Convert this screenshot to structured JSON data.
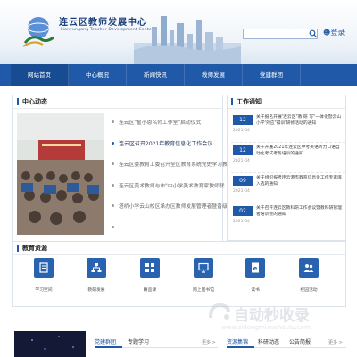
{
  "header": {
    "logo_title": "连云区教师发展中心",
    "logo_subtitle": "Lianyungang Teacher Development Center",
    "search_placeholder": "",
    "login_label": "登录"
  },
  "nav": {
    "items": [
      "网站首页",
      "中心概况",
      "新闻快讯",
      "教师发展",
      "党建群团"
    ]
  },
  "center_news": {
    "title": "中心动态",
    "items": [
      {
        "text": "连云区\"星小恩名师工作室\"启动仪式",
        "active": false
      },
      {
        "text": "连云区召开2021年教育信息化工作会议",
        "active": true
      },
      {
        "text": "连云区委教育工委召开全区教育系统党史学习教",
        "active": false
      },
      {
        "text": "连云区美术教师与市\"中小学美术教育家教师联",
        "active": false
      },
      {
        "text": "塔桥小学云山校区承办区教师发展管理者暨晋级",
        "active": false
      },
      {
        "text": "",
        "active": false
      }
    ]
  },
  "work_notice": {
    "title": "工作通知",
    "items": [
      {
        "day": "12",
        "year": "2021-04",
        "text": "关于报名开展'连云区\"教 研 写\"一体化暨云山小学'外应\"得训'研修活动的通知"
      },
      {
        "day": "12",
        "year": "2021-04",
        "text": "关于开展2021年连云区中考英语听力口语自动化考试考务培训的通知"
      },
      {
        "day": "09",
        "year": "2021-04",
        "text": "关于组织报考连云港市教育信息化工作专家库入选的通知"
      },
      {
        "day": "02",
        "year": "2021-04",
        "text": "关于召开连云区教科研工作会议暨教科研管理者培训会的通知"
      }
    ]
  },
  "resources": {
    "title": "教育资源",
    "items": [
      {
        "label": "学习空间",
        "icon": "book-icon"
      },
      {
        "label": "教研发展",
        "icon": "network-icon"
      },
      {
        "label": "精品课",
        "icon": "grid-icon"
      },
      {
        "label": "网上图书馆",
        "icon": "monitor-icon"
      },
      {
        "label": "读书",
        "icon": "ebook-icon"
      },
      {
        "label": "校园活动",
        "icon": "people-icon"
      }
    ]
  },
  "bottom": {
    "tabs_left": [
      "党建群团",
      "专题学习"
    ],
    "tabs_right": [
      "资源集锦",
      "科研动态",
      "公告简报"
    ],
    "more_label": "更多 >"
  },
  "watermark": {
    "text": "自动秒收录",
    "url": "www.zidongmiaoshoulu.com"
  },
  "colors": {
    "primary": "#2059a7",
    "nav_bg": "#2059a7",
    "date_badge": "#2059a7"
  }
}
